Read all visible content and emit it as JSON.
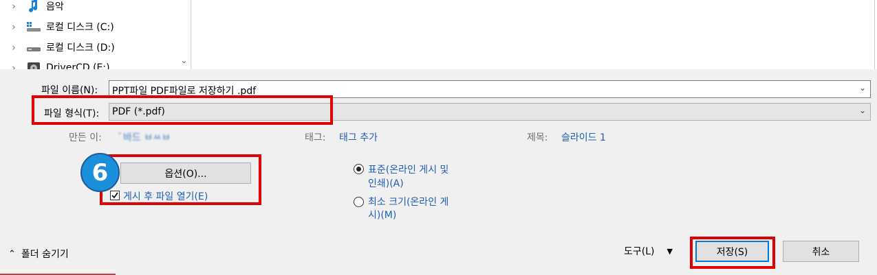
{
  "nav": {
    "items": [
      {
        "label": "음악",
        "icon": "music-note-icon"
      },
      {
        "label": "로컬 디스크 (C:)",
        "icon": "windows-drive-icon"
      },
      {
        "label": "로컬 디스크 (D:)",
        "icon": "drive-icon"
      },
      {
        "label": "DriverCD (E:)",
        "icon": "cd-drive-icon"
      }
    ]
  },
  "form": {
    "filename_label": "파일 이름(N):",
    "filename_value": "PPT파일 PDF파일로 저장하기 .pdf",
    "filetype_label": "파일 형식(T):",
    "filetype_value": "PDF (*.pdf)"
  },
  "meta": {
    "author_label": "만든 이:",
    "author_value": "ﾞ바드 ㅂㅆㅂ",
    "tags_label": "태그:",
    "tags_value": "태그 추가",
    "title_label": "제목:",
    "title_value": "슬라이드 1"
  },
  "options": {
    "options_button": "옵션(O)...",
    "open_after_publish": "게시 후 파일 열기(E)",
    "step_number": "6"
  },
  "optimize": {
    "standard_label_line1": "표준(온라인 게시 및",
    "standard_label_line2": "인쇄)(A)",
    "minimum_label_line1": "최소 크기(온라인 게",
    "minimum_label_line2": "시)(M)"
  },
  "footer": {
    "hide_folders": "폴더 숨기기",
    "tools": "도구(L)",
    "save": "저장(S)",
    "cancel": "취소"
  },
  "colors": {
    "highlight_box": "#e00000",
    "badge": "#1c8fdb",
    "link_blue": "#1e5eb5"
  }
}
